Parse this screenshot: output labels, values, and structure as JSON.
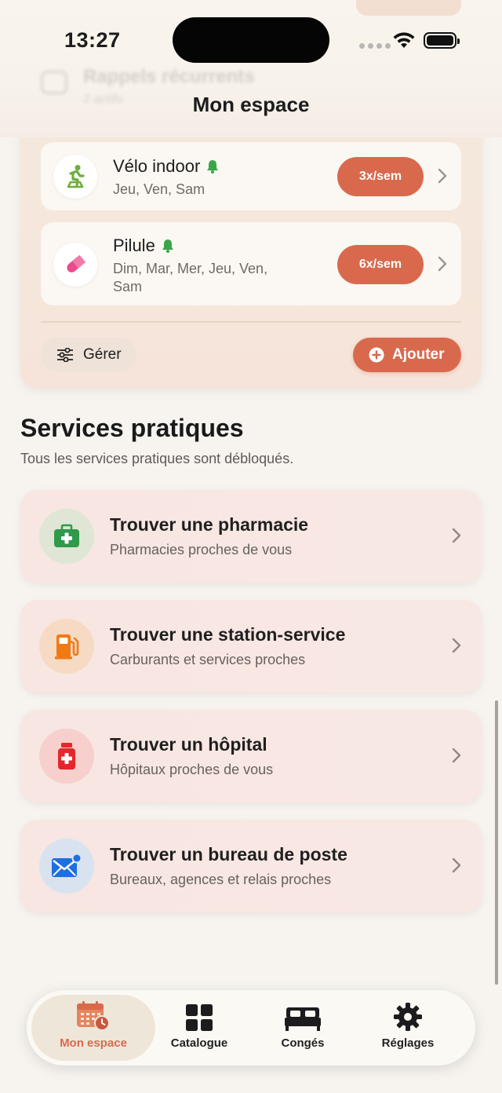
{
  "status_bar": {
    "time": "13:27"
  },
  "ghost_header": {
    "title": "Rappels récurrents",
    "subtitle": "2 actifs"
  },
  "header": {
    "title": "Mon espace"
  },
  "reminders": {
    "items": [
      {
        "name": "Vélo indoor",
        "days": "Jeu, Ven, Sam",
        "frequency": "3x/sem",
        "icon": "bike-icon"
      },
      {
        "name": "Pilule",
        "days": "Dim, Mar, Mer, Jeu, Ven, Sam",
        "frequency": "6x/sem",
        "icon": "pill-icon"
      }
    ],
    "manage_label": "Gérer",
    "add_label": "Ajouter"
  },
  "services": {
    "title": "Services pratiques",
    "subtitle": "Tous les services pratiques sont débloqués.",
    "items": [
      {
        "name": "Trouver une pharmacie",
        "desc": "Pharmacies proches de vous",
        "icon": "medkit-icon",
        "icon_bg": "#dfe6d5"
      },
      {
        "name": "Trouver une station-service",
        "desc": "Carburants et services proches",
        "icon": "fuel-pump-icon",
        "icon_bg": "#f7dac4"
      },
      {
        "name": "Trouver un hôpital",
        "desc": "Hôpitaux proches de vous",
        "icon": "hospital-bottle-icon",
        "icon_bg": "#f7cfcc"
      },
      {
        "name": "Trouver un bureau de poste",
        "desc": "Bureaux, agences et relais proches",
        "icon": "mail-icon",
        "icon_bg": "#d9e3f0"
      }
    ]
  },
  "tabbar": {
    "tabs": [
      {
        "label": "Mon espace",
        "active": true,
        "icon": "calendar-clock-icon"
      },
      {
        "label": "Catalogue",
        "active": false,
        "icon": "grid-icon"
      },
      {
        "label": "Congés",
        "active": false,
        "icon": "bed-icon"
      },
      {
        "label": "Réglages",
        "active": false,
        "icon": "gear-icon"
      }
    ]
  },
  "colors": {
    "accent": "#d9694d",
    "bell": "#3aa64a"
  }
}
